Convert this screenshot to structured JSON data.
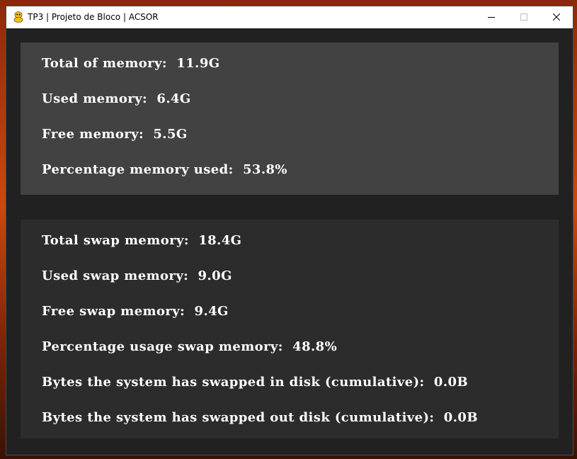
{
  "window": {
    "title": "TP3 | Projeto de Bloco | ACSOR"
  },
  "memory": {
    "lines": [
      "Total of memory:  11.9G",
      "Used memory:  6.4G",
      "Free memory:  5.5G",
      "Percentage memory used:  53.8%"
    ]
  },
  "swap": {
    "lines": [
      "Total swap memory:  18.4G",
      "Used swap memory:  9.0G",
      "Free swap memory:  9.4G",
      "Percentage usage swap memory:  48.8%",
      "Bytes the system has swapped in disk (cumulative):  0.0B",
      "Bytes the system has swapped out disk (cumulative):  0.0B"
    ]
  },
  "colors": {
    "window_bg": "#212121",
    "memory_panel_bg": "#424242",
    "swap_panel_bg": "#2c2c2c",
    "text": "#ffffff"
  }
}
